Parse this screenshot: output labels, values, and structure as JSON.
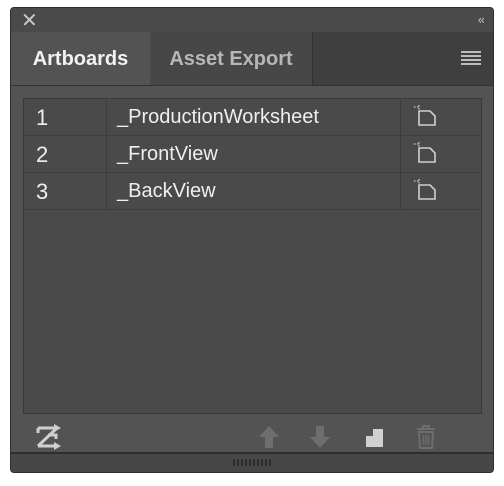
{
  "window": {
    "close_icon": "close-icon",
    "collapse_icon": "collapse-chevrons-icon",
    "close_glyph": "✕",
    "collapse_glyph": "‹‹"
  },
  "tabs": [
    {
      "label": "Artboards",
      "active": true
    },
    {
      "label": "Asset Export",
      "active": false
    }
  ],
  "panel_menu_icon": "hamburger-menu-icon",
  "artboards": [
    {
      "number": "1",
      "name": "_ProductionWorksheet"
    },
    {
      "number": "2",
      "name": "_FrontView"
    },
    {
      "number": "3",
      "name": "_BackView"
    }
  ],
  "footer_buttons": [
    {
      "icon": "rearrange-artboards-icon",
      "enabled": true
    },
    {
      "icon": "move-up-icon",
      "enabled": false
    },
    {
      "icon": "move-down-icon",
      "enabled": false
    },
    {
      "icon": "new-artboard-icon",
      "enabled": true
    },
    {
      "icon": "delete-artboard-icon",
      "enabled": false
    }
  ],
  "colors": {
    "panel_bg": "#535353",
    "tab_bar_bg": "#3f3f3f",
    "text_primary": "#efefef",
    "text_secondary": "#b7b7b7",
    "icon_enabled": "#d0d0d0",
    "icon_disabled": "#6e6e6e"
  }
}
